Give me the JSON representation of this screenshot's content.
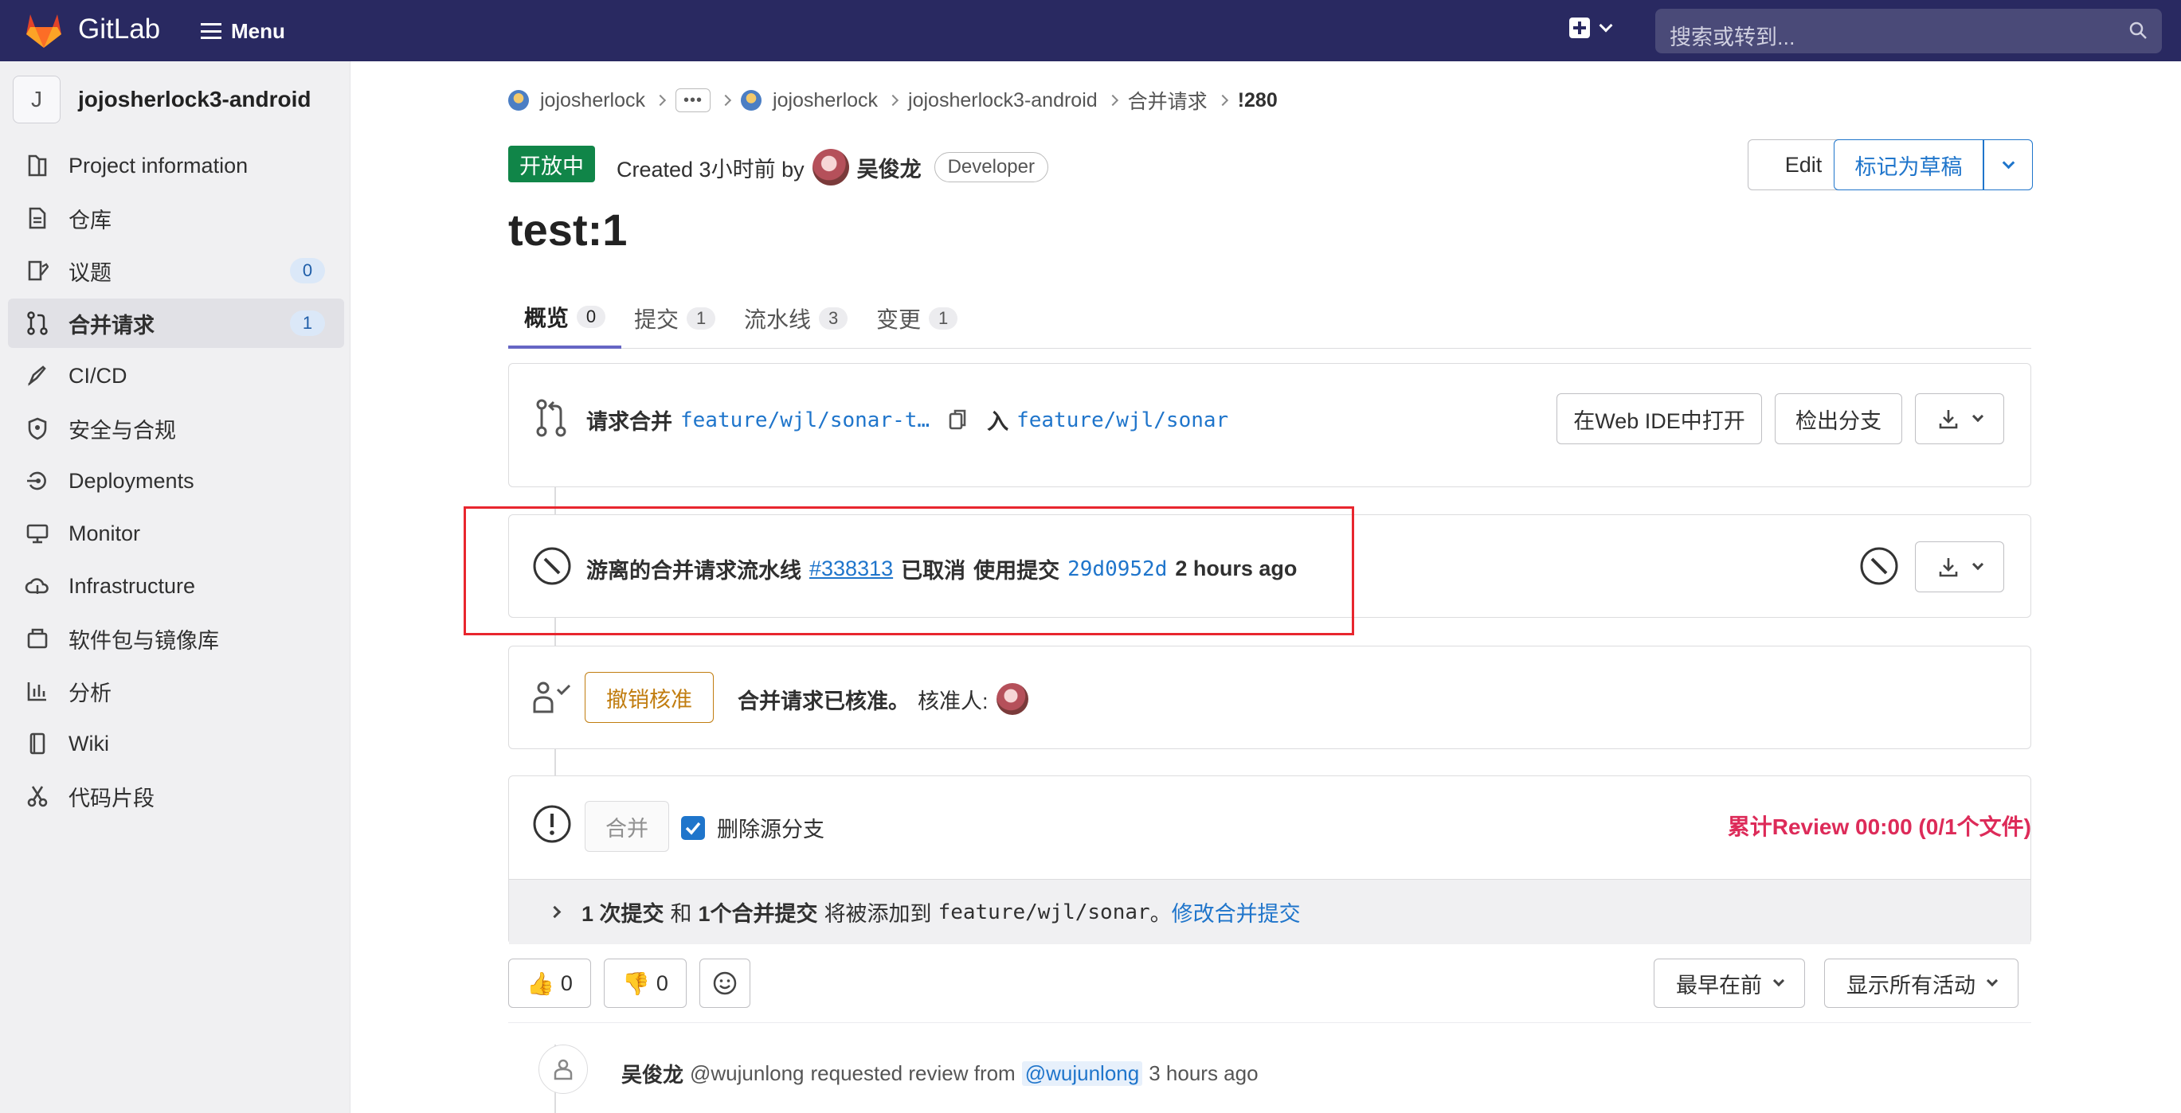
{
  "navbar": {
    "brand": "GitLab",
    "menu_label": "Menu",
    "search_placeholder": "搜索或转到...",
    "accent": "#292961"
  },
  "sidebar": {
    "project_initial": "J",
    "project_name": "jojosherlock3-android",
    "items": [
      {
        "label": "Project information",
        "icon": "book-icon"
      },
      {
        "label": "仓库",
        "icon": "document-icon"
      },
      {
        "label": "议题",
        "icon": "issues-icon",
        "badge": "0"
      },
      {
        "label": "合并请求",
        "icon": "merge-request-icon",
        "badge": "1",
        "active": true
      },
      {
        "label": "CI/CD",
        "icon": "rocket-icon"
      },
      {
        "label": "安全与合规",
        "icon": "shield-icon"
      },
      {
        "label": "Deployments",
        "icon": "deployments-icon"
      },
      {
        "label": "Monitor",
        "icon": "monitor-icon"
      },
      {
        "label": "Infrastructure",
        "icon": "cloud-icon"
      },
      {
        "label": "软件包与镜像库",
        "icon": "package-icon"
      },
      {
        "label": "分析",
        "icon": "chart-icon"
      },
      {
        "label": "Wiki",
        "icon": "wiki-icon"
      },
      {
        "label": "代码片段",
        "icon": "scissors-icon"
      }
    ]
  },
  "breadcrumb": {
    "items": [
      "jojosherlock",
      "jojosherlock",
      "jojosherlock3-android",
      "合并请求",
      "!280"
    ],
    "more": "•••"
  },
  "header": {
    "status": "开放中",
    "created_prefix": "Created 3小时前 by",
    "author": "吴俊龙",
    "role": "Developer",
    "edit_label": "Edit",
    "draft_label": "标记为草稿",
    "title": "test:1"
  },
  "tabs": [
    {
      "label": "概览",
      "count": "0"
    },
    {
      "label": "提交",
      "count": "1"
    },
    {
      "label": "流水线",
      "count": "3"
    },
    {
      "label": "变更",
      "count": "1"
    }
  ],
  "merge_info": {
    "request_prefix": "请求合并",
    "source_branch": "feature/wjl/sonar-t…",
    "into": "入",
    "target_branch": "feature/wjl/sonar",
    "web_ide_label": "在Web IDE中打开",
    "checkout_label": "检出分支"
  },
  "pipeline": {
    "prefix": "游离的合并请求流水线",
    "id": "#338313",
    "status": "已取消",
    "commit_prefix": "使用提交",
    "commit": "29d0952d",
    "time": "2 hours ago"
  },
  "approval": {
    "revoke_label": "撤销核准",
    "text": "合并请求已核准。",
    "approvers_label": "核准人:"
  },
  "merge": {
    "merge_label": "合并",
    "delete_source_label": "删除源分支",
    "review_warning": "累计Review 00:00 (0/1个文件)",
    "commits_strong1": "1 次提交",
    "commits_and": "和",
    "commits_strong2": "1个合并提交",
    "commits_rest": "将被添加到",
    "commits_branch": "feature/wjl/sonar",
    "commits_period": "。",
    "modify_link": "修改合并提交"
  },
  "reactions": {
    "thumbs_up": "0",
    "thumbs_down": "0",
    "sort_label": "最早在前",
    "filter_label": "显示所有活动"
  },
  "activity": {
    "author": "吴俊龙",
    "handle": "@wujunlong",
    "text": "requested review from",
    "mention": "@wujunlong",
    "time": "3 hours ago"
  }
}
